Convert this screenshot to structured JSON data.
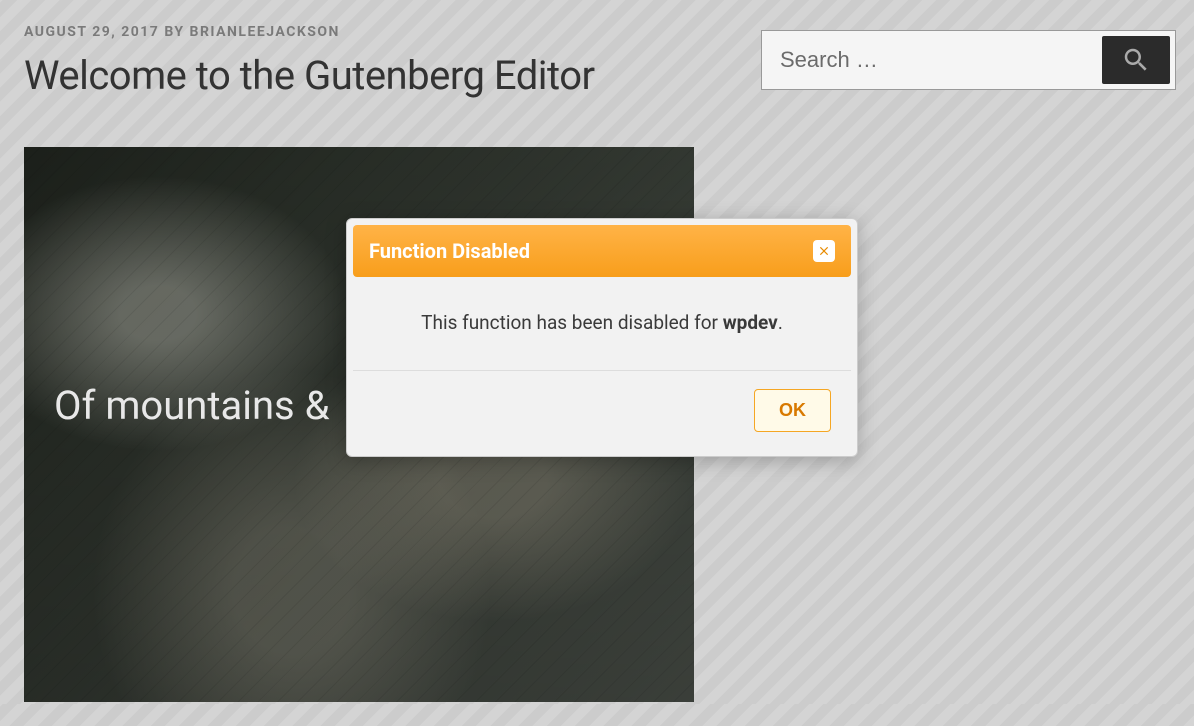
{
  "post": {
    "date": "AUGUST 29, 2017",
    "by_label": "BY",
    "author": "BRIANLEEJACKSON",
    "title": "Welcome to the Gutenberg Editor",
    "image_overlay_text": "Of mountains &"
  },
  "search": {
    "placeholder": "Search …",
    "value": ""
  },
  "modal": {
    "title": "Function Disabled",
    "message_prefix": "This function has been disabled for ",
    "message_bold": "wpdev",
    "message_suffix": ".",
    "ok_label": "OK"
  }
}
